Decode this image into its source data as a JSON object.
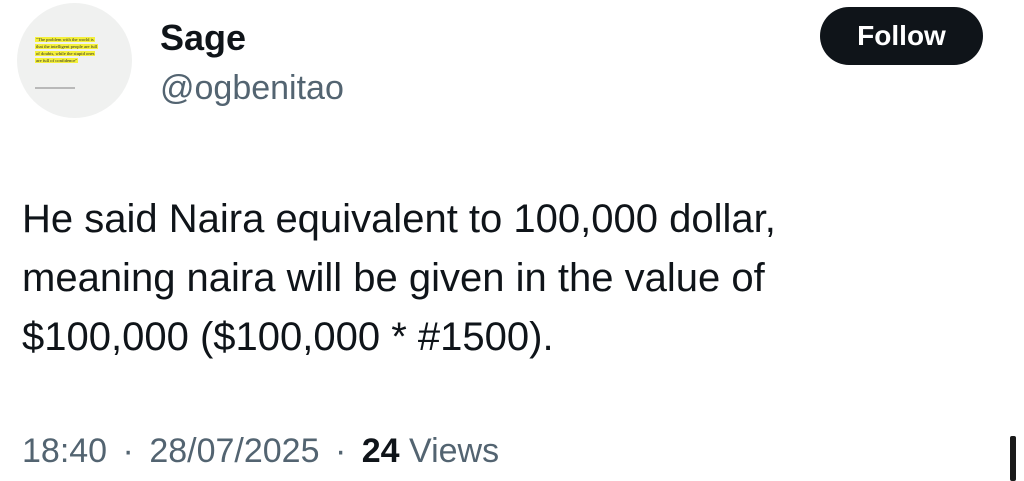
{
  "author": {
    "display_name": "Sage",
    "handle": "@ogbenitao",
    "avatar": {
      "quote_lines": [
        "\"The problem with the world is",
        "that the intelligent people are full",
        "of doubts, while the stupid ones",
        "are full of confidence\""
      ],
      "highlight_color": "#f4f03a"
    }
  },
  "follow_button": {
    "label": "Follow"
  },
  "tweet": {
    "lines": [
      "He said Naira equivalent to 100,000 dollar,",
      "meaning naira will be given in the value of",
      "$100,000 ($100,000 * #1500)."
    ]
  },
  "meta": {
    "time": "18:40",
    "separator": "·",
    "date": "28/07/2025",
    "views_count": "24",
    "views_label": "Views"
  },
  "colors": {
    "text_primary": "#0f1419",
    "text_secondary": "#536471",
    "button_bg": "#0f1419",
    "button_text": "#ffffff"
  }
}
